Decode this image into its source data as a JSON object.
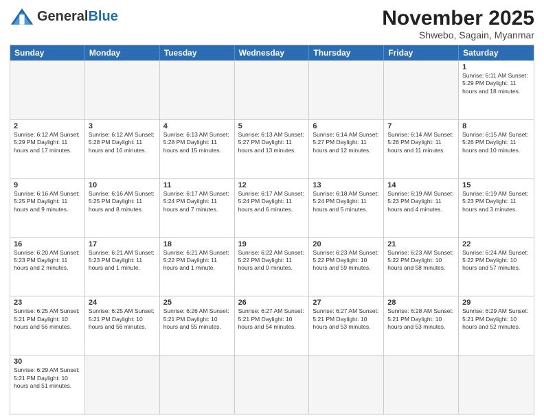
{
  "header": {
    "logo_general": "General",
    "logo_blue": "Blue",
    "month_title": "November 2025",
    "subtitle": "Shwebo, Sagain, Myanmar"
  },
  "weekdays": [
    "Sunday",
    "Monday",
    "Tuesday",
    "Wednesday",
    "Thursday",
    "Friday",
    "Saturday"
  ],
  "rows": [
    [
      {
        "day": "",
        "info": "",
        "empty": true
      },
      {
        "day": "",
        "info": "",
        "empty": true
      },
      {
        "day": "",
        "info": "",
        "empty": true
      },
      {
        "day": "",
        "info": "",
        "empty": true
      },
      {
        "day": "",
        "info": "",
        "empty": true
      },
      {
        "day": "",
        "info": "",
        "empty": true
      },
      {
        "day": "1",
        "info": "Sunrise: 6:11 AM\nSunset: 5:29 PM\nDaylight: 11 hours\nand 18 minutes.",
        "empty": false
      }
    ],
    [
      {
        "day": "2",
        "info": "Sunrise: 6:12 AM\nSunset: 5:29 PM\nDaylight: 11 hours\nand 17 minutes.",
        "empty": false
      },
      {
        "day": "3",
        "info": "Sunrise: 6:12 AM\nSunset: 5:28 PM\nDaylight: 11 hours\nand 16 minutes.",
        "empty": false
      },
      {
        "day": "4",
        "info": "Sunrise: 6:13 AM\nSunset: 5:28 PM\nDaylight: 11 hours\nand 15 minutes.",
        "empty": false
      },
      {
        "day": "5",
        "info": "Sunrise: 6:13 AM\nSunset: 5:27 PM\nDaylight: 11 hours\nand 13 minutes.",
        "empty": false
      },
      {
        "day": "6",
        "info": "Sunrise: 6:14 AM\nSunset: 5:27 PM\nDaylight: 11 hours\nand 12 minutes.",
        "empty": false
      },
      {
        "day": "7",
        "info": "Sunrise: 6:14 AM\nSunset: 5:26 PM\nDaylight: 11 hours\nand 11 minutes.",
        "empty": false
      },
      {
        "day": "8",
        "info": "Sunrise: 6:15 AM\nSunset: 5:26 PM\nDaylight: 11 hours\nand 10 minutes.",
        "empty": false
      }
    ],
    [
      {
        "day": "9",
        "info": "Sunrise: 6:16 AM\nSunset: 5:25 PM\nDaylight: 11 hours\nand 9 minutes.",
        "empty": false
      },
      {
        "day": "10",
        "info": "Sunrise: 6:16 AM\nSunset: 5:25 PM\nDaylight: 11 hours\nand 8 minutes.",
        "empty": false
      },
      {
        "day": "11",
        "info": "Sunrise: 6:17 AM\nSunset: 5:24 PM\nDaylight: 11 hours\nand 7 minutes.",
        "empty": false
      },
      {
        "day": "12",
        "info": "Sunrise: 6:17 AM\nSunset: 5:24 PM\nDaylight: 11 hours\nand 6 minutes.",
        "empty": false
      },
      {
        "day": "13",
        "info": "Sunrise: 6:18 AM\nSunset: 5:24 PM\nDaylight: 11 hours\nand 5 minutes.",
        "empty": false
      },
      {
        "day": "14",
        "info": "Sunrise: 6:19 AM\nSunset: 5:23 PM\nDaylight: 11 hours\nand 4 minutes.",
        "empty": false
      },
      {
        "day": "15",
        "info": "Sunrise: 6:19 AM\nSunset: 5:23 PM\nDaylight: 11 hours\nand 3 minutes.",
        "empty": false
      }
    ],
    [
      {
        "day": "16",
        "info": "Sunrise: 6:20 AM\nSunset: 5:23 PM\nDaylight: 11 hours\nand 2 minutes.",
        "empty": false
      },
      {
        "day": "17",
        "info": "Sunrise: 6:21 AM\nSunset: 5:23 PM\nDaylight: 11 hours\nand 1 minute.",
        "empty": false
      },
      {
        "day": "18",
        "info": "Sunrise: 6:21 AM\nSunset: 5:22 PM\nDaylight: 11 hours\nand 1 minute.",
        "empty": false
      },
      {
        "day": "19",
        "info": "Sunrise: 6:22 AM\nSunset: 5:22 PM\nDaylight: 11 hours\nand 0 minutes.",
        "empty": false
      },
      {
        "day": "20",
        "info": "Sunrise: 6:23 AM\nSunset: 5:22 PM\nDaylight: 10 hours\nand 59 minutes.",
        "empty": false
      },
      {
        "day": "21",
        "info": "Sunrise: 6:23 AM\nSunset: 5:22 PM\nDaylight: 10 hours\nand 58 minutes.",
        "empty": false
      },
      {
        "day": "22",
        "info": "Sunrise: 6:24 AM\nSunset: 5:22 PM\nDaylight: 10 hours\nand 57 minutes.",
        "empty": false
      }
    ],
    [
      {
        "day": "23",
        "info": "Sunrise: 6:25 AM\nSunset: 5:21 PM\nDaylight: 10 hours\nand 56 minutes.",
        "empty": false
      },
      {
        "day": "24",
        "info": "Sunrise: 6:25 AM\nSunset: 5:21 PM\nDaylight: 10 hours\nand 56 minutes.",
        "empty": false
      },
      {
        "day": "25",
        "info": "Sunrise: 6:26 AM\nSunset: 5:21 PM\nDaylight: 10 hours\nand 55 minutes.",
        "empty": false
      },
      {
        "day": "26",
        "info": "Sunrise: 6:27 AM\nSunset: 5:21 PM\nDaylight: 10 hours\nand 54 minutes.",
        "empty": false
      },
      {
        "day": "27",
        "info": "Sunrise: 6:27 AM\nSunset: 5:21 PM\nDaylight: 10 hours\nand 53 minutes.",
        "empty": false
      },
      {
        "day": "28",
        "info": "Sunrise: 6:28 AM\nSunset: 5:21 PM\nDaylight: 10 hours\nand 53 minutes.",
        "empty": false
      },
      {
        "day": "29",
        "info": "Sunrise: 6:29 AM\nSunset: 5:21 PM\nDaylight: 10 hours\nand 52 minutes.",
        "empty": false
      }
    ],
    [
      {
        "day": "30",
        "info": "Sunrise: 6:29 AM\nSunset: 5:21 PM\nDaylight: 10 hours\nand 51 minutes.",
        "empty": false
      },
      {
        "day": "",
        "info": "",
        "empty": true
      },
      {
        "day": "",
        "info": "",
        "empty": true
      },
      {
        "day": "",
        "info": "",
        "empty": true
      },
      {
        "day": "",
        "info": "",
        "empty": true
      },
      {
        "day": "",
        "info": "",
        "empty": true
      },
      {
        "day": "",
        "info": "",
        "empty": true
      }
    ]
  ]
}
